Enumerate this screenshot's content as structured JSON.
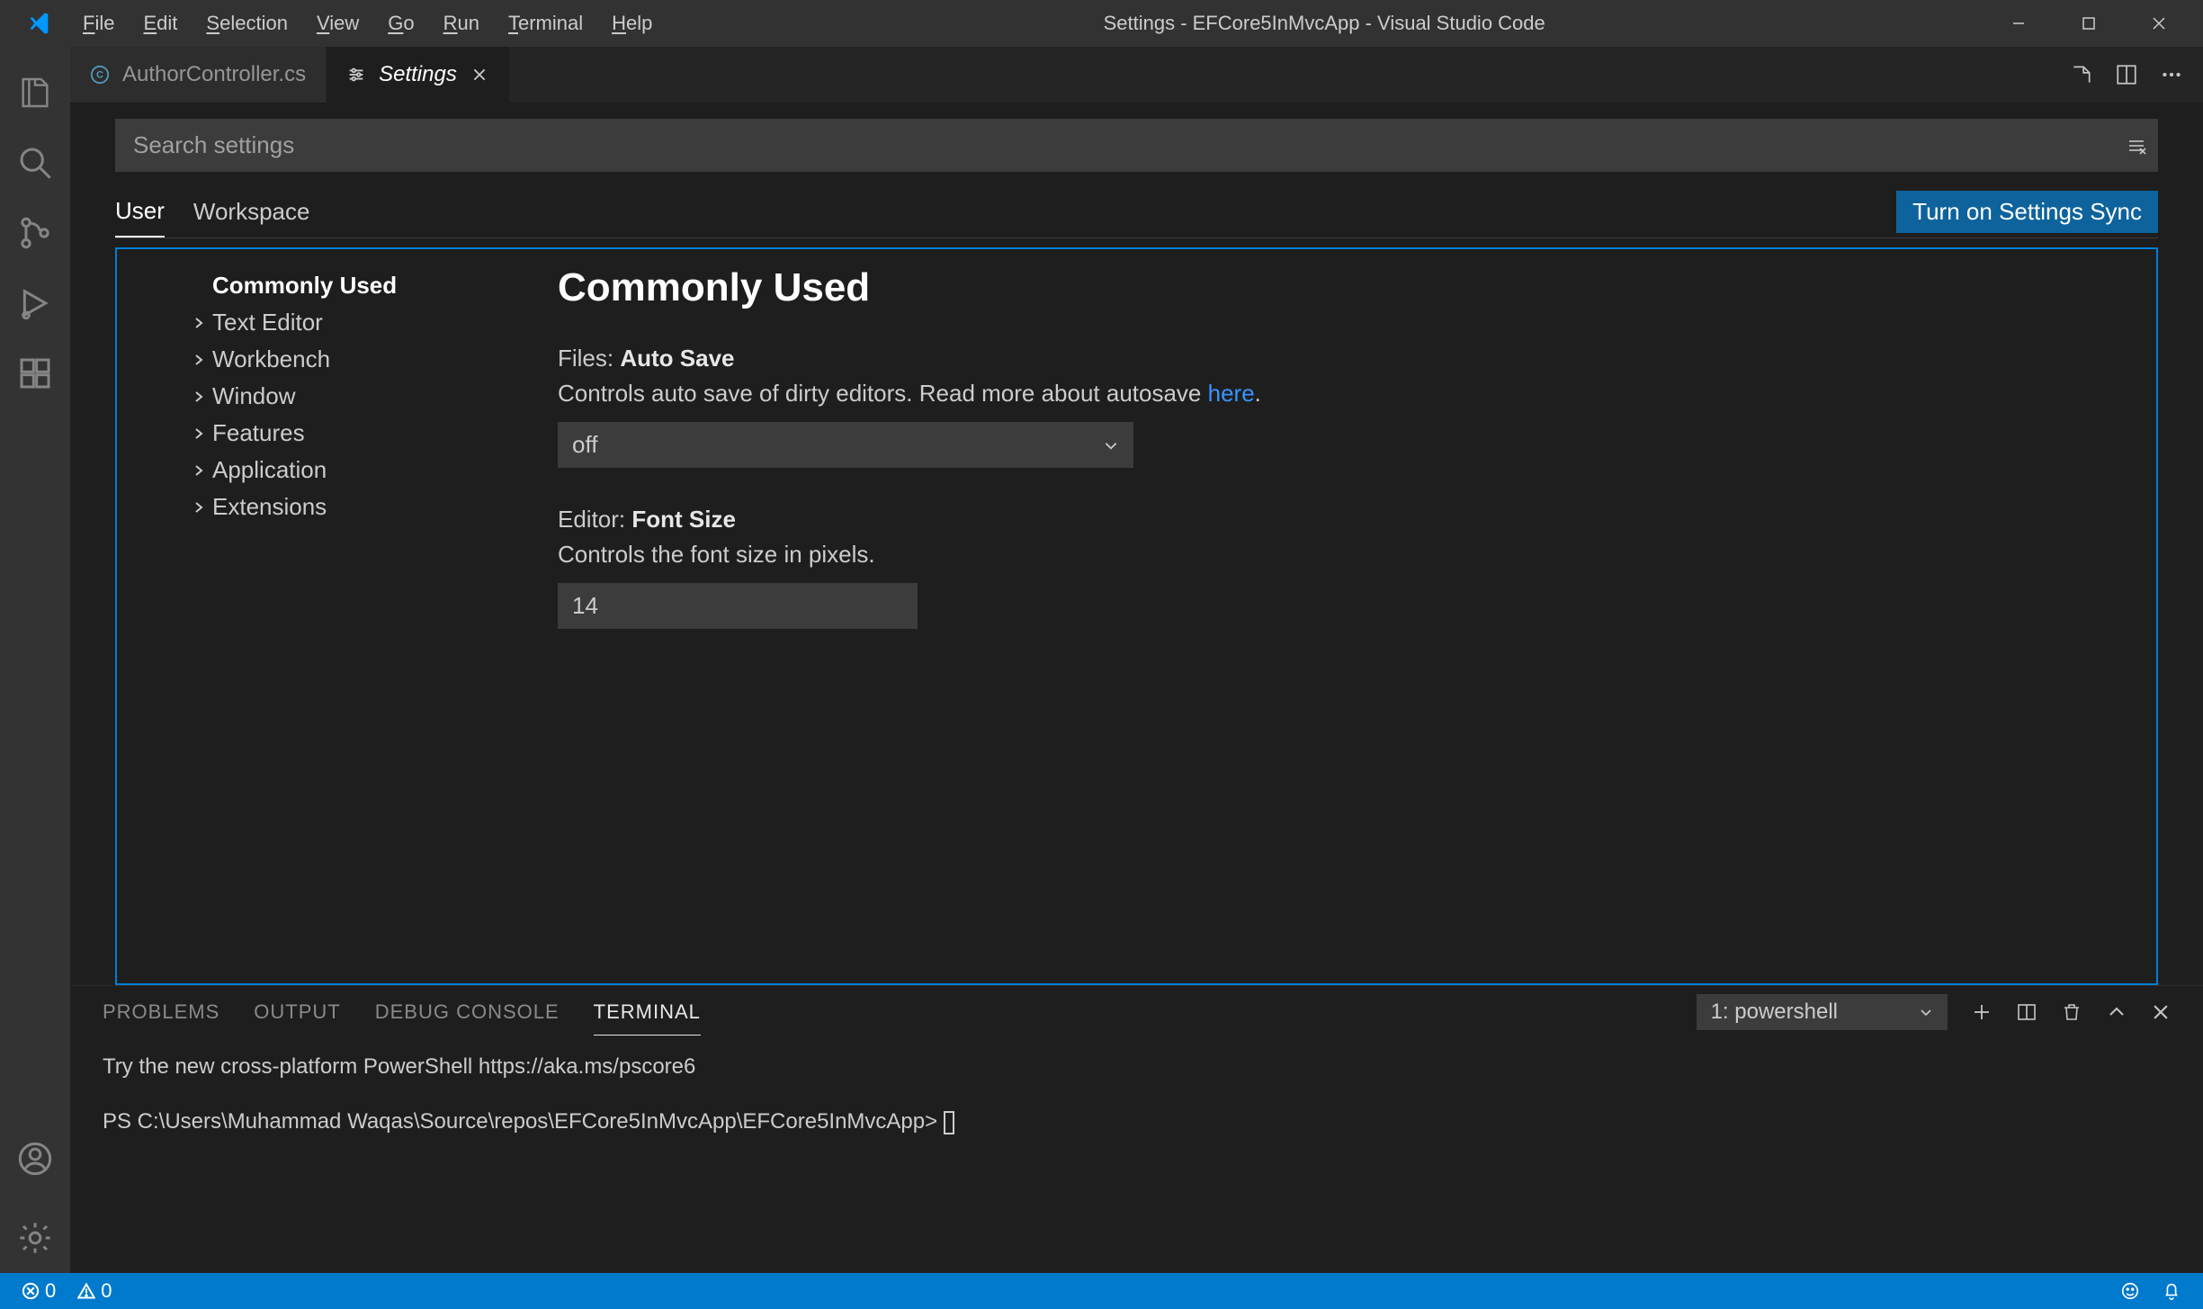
{
  "titlebar": {
    "title": "Settings - EFCore5InMvcApp - Visual Studio Code",
    "menu": [
      "File",
      "Edit",
      "Selection",
      "View",
      "Go",
      "Run",
      "Terminal",
      "Help"
    ]
  },
  "tabs": {
    "items": [
      {
        "label": "AuthorController.cs"
      },
      {
        "label": "Settings"
      }
    ]
  },
  "search": {
    "placeholder": "Search settings"
  },
  "scopeTabs": {
    "user": "User",
    "workspace": "Workspace",
    "sync": "Turn on Settings Sync"
  },
  "toc": {
    "items": [
      {
        "label": "Commonly Used",
        "chev": false,
        "selected": true
      },
      {
        "label": "Text Editor",
        "chev": true
      },
      {
        "label": "Workbench",
        "chev": true
      },
      {
        "label": "Window",
        "chev": true
      },
      {
        "label": "Features",
        "chev": true
      },
      {
        "label": "Application",
        "chev": true
      },
      {
        "label": "Extensions",
        "chev": true
      }
    ]
  },
  "group": {
    "title": "Commonly Used"
  },
  "settings": {
    "autoSave": {
      "cat": "Files:",
      "name": "Auto Save",
      "desc_prefix": "Controls auto save of dirty editors. Read more about autosave ",
      "link": "here",
      "value": "off"
    },
    "fontSize": {
      "cat": "Editor:",
      "name": "Font Size",
      "desc": "Controls the font size in pixels.",
      "value": "14"
    }
  },
  "panel": {
    "tabs": [
      "PROBLEMS",
      "OUTPUT",
      "DEBUG CONSOLE",
      "TERMINAL"
    ],
    "termSelect": "1: powershell",
    "line1": "Try the new cross-platform PowerShell https://aka.ms/pscore6",
    "prompt": "PS C:\\Users\\Muhammad Waqas\\Source\\repos\\EFCore5InMvcApp\\EFCore5InMvcApp> "
  },
  "status": {
    "errors": "0",
    "warnings": "0"
  }
}
